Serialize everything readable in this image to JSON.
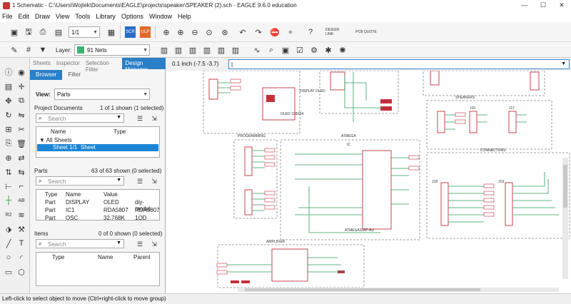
{
  "window": {
    "title": "1 Schematic - C:\\Users\\Wojtek\\Documents\\EAGLE\\projects\\speaker\\SPEAKER (2).sch - EAGLE 9.6.0 education",
    "controls": [
      "—",
      "☐",
      "✕"
    ]
  },
  "menu": [
    "File",
    "Edit",
    "Draw",
    "View",
    "Tools",
    "Library",
    "Options",
    "Window",
    "Help"
  ],
  "toolbar": {
    "sheet_select": "1/1",
    "scr_label": "SCR",
    "ulp_label": "ULP",
    "design_link": "DESIGN LINK",
    "pcb_quote": "PCB QUOTE",
    "layer_label": "Layer:",
    "layer_value": "91 Nets",
    "layer_color": "#3cb371"
  },
  "panel": {
    "tabs": [
      "Sheets",
      "Inspector",
      "Selection Filter",
      "Design Manager"
    ],
    "active_tab": "Design Manager",
    "subtabs": [
      "Browser",
      "Filter"
    ],
    "view_label": "View:",
    "view_value": "Parts",
    "project_docs": {
      "title": "Project Documents",
      "count": "1 of 1 shown (1 selected)",
      "search": "Search",
      "headers": [
        "Name",
        "Type"
      ],
      "tree_root": "All Sheets",
      "tree_item": "Sheet 1/1",
      "tree_item_type": "Sheet"
    },
    "parts": {
      "title": "Parts",
      "count": "63 of 63 shown (0 selected)",
      "search": "Search",
      "headers": [
        "Type",
        "Name",
        "Value",
        ""
      ],
      "rows": [
        {
          "type": "Part",
          "name": "DISPLAY",
          "value": "OLED",
          "extra": "diy-modul"
        },
        {
          "type": "Part",
          "name": "IC1",
          "value": "RDA5807",
          "extra": "RDA5807"
        },
        {
          "type": "Part",
          "name": "OSC",
          "value": "32.768K",
          "extra": "1QD Freq"
        }
      ]
    },
    "items": {
      "title": "Items",
      "count": "0 of 0 shown (0 selected)",
      "search": "Search",
      "headers": [
        "Type",
        "Name",
        "Parent"
      ]
    }
  },
  "command": {
    "coord": "0.1 inch (-7.5 -3.7)",
    "value": "|"
  },
  "schematic": {
    "labels": [
      "SPEAKERS",
      "PROGRAMMING",
      "ATMEGA",
      "IC",
      "CONNECTORS",
      "AMPLIFIER",
      "DISPLAY OLED",
      "ATMEGA328P-AU",
      "J15",
      "J17",
      "J18",
      "J19",
      "OLED 128X64"
    ]
  },
  "status": "Left-click to select object to move (Ctrl+right-click to move group)"
}
